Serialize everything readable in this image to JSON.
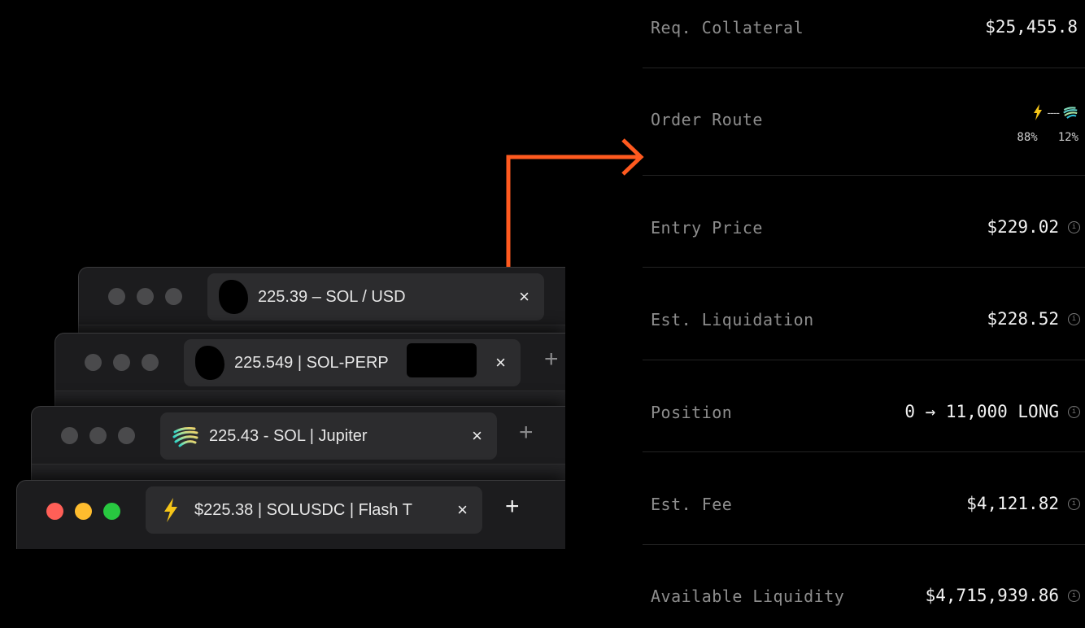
{
  "browser_windows": [
    {
      "tab_title": "225.39 – SOL / USD",
      "favicon": "redacted-blob",
      "close_icon": "×",
      "new_tab_icon": ""
    },
    {
      "tab_title": "225.549 | SOL-PERP",
      "favicon": "redacted-blob",
      "close_icon": "×",
      "new_tab_icon": "+"
    },
    {
      "tab_title": "225.43 - SOL | Jupiter",
      "favicon": "jupiter-logo-icon",
      "close_icon": "×",
      "new_tab_icon": "+"
    },
    {
      "tab_title": "$225.38 | SOLUSDC | Flash T",
      "favicon": "lightning-bolt-icon",
      "close_icon": "×",
      "new_tab_icon": "+"
    }
  ],
  "arrow_color": "#ff5a1f",
  "trade_details": {
    "rows": [
      {
        "label": "Req. Collateral",
        "value": "$25,455.8"
      },
      {
        "label": "Order Route",
        "value": ""
      },
      {
        "label": "Entry Price",
        "value": "$229.02"
      },
      {
        "label": "Est. Liquidation",
        "value": "$228.52"
      },
      {
        "label": "Position",
        "value": "0 → 11,000 LONG"
      },
      {
        "label": "Est. Fee",
        "value": "$4,121.82"
      },
      {
        "label": "Available Liquidity",
        "value": "$4,715,939.86"
      }
    ],
    "order_route": {
      "pct_flash": "88%",
      "pct_jupiter": "12%",
      "icons": [
        "lightning-bolt-icon",
        "jupiter-logo-icon"
      ]
    },
    "info_icon": "i"
  }
}
